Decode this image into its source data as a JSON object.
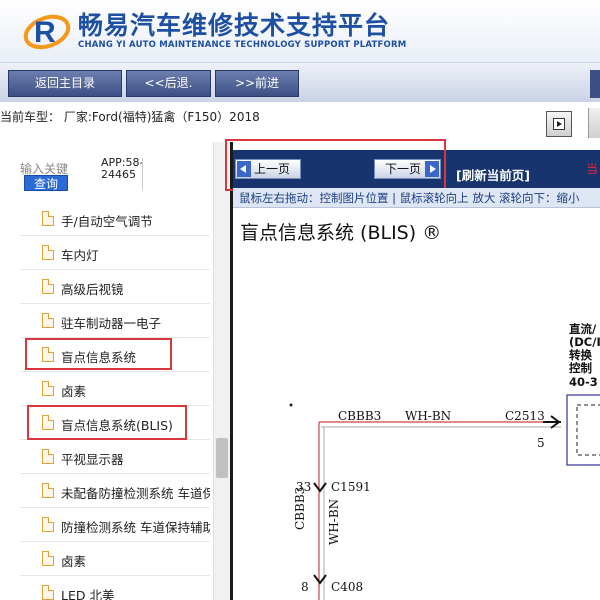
{
  "header": {
    "title_cn": "畅易汽车维修技术支持平台",
    "title_en": "CHANG YI AUTO MAINTENANCE TECHNOLOGY SUPPORT PLATFORM"
  },
  "toolbar": {
    "home_label": "返回主目录",
    "back_label": "<<后退.",
    "forward_label": ">>前进"
  },
  "vehicle": {
    "text": "当前车型：  厂家:Ford(福特)猛禽（F150）2018"
  },
  "sidebar": {
    "search_label": "输入关键",
    "search_button": "查询",
    "app_line1": "APP:58-",
    "app_line2": "24465",
    "items": [
      {
        "label": "手/自动空气调节"
      },
      {
        "label": "车内灯"
      },
      {
        "label": "高级后视镜"
      },
      {
        "label": "驻车制动器一电子"
      },
      {
        "label": "盲点信息系统"
      },
      {
        "label": "卤素"
      },
      {
        "label": "盲点信息系统(BLIS)"
      },
      {
        "label": "平视显示器"
      },
      {
        "label": "未配备防撞检测系统 车道保"
      },
      {
        "label": "防撞检测系统 车道保持辅助"
      },
      {
        "label": "卤素"
      },
      {
        "label": "LED 北美"
      }
    ]
  },
  "viewer": {
    "prev_label": "上一页",
    "next_label": "下一页",
    "refresh_label": "[刷新当前页]",
    "current_label": "当",
    "hint": "鼠标左右拖动：控制图片位置 | 鼠标滚轮向上 放大  滚轮向下：缩小",
    "page_title": "盲点信息系统 (BLIS) ®"
  },
  "diagram": {
    "right_label_l1": "直流/",
    "right_label_l2": "(DC/I",
    "right_label_l3": "转换",
    "right_label_l4": "控制",
    "right_label_l5": "40-3",
    "wire_circuit": "CBBB3",
    "wire_color": "WH-BN",
    "connector_right": "C2513",
    "pin_right": "5",
    "pin_top": "33",
    "connector_mid": "C1591",
    "vertical_circuit": "CBBB3",
    "vertical_color": "WH-BN",
    "pin_bottom": "8",
    "connector_bottom": "C408"
  },
  "colors": {
    "brand_blue": "#1d4fa3",
    "nav_bar": "#17346e",
    "highlight_red": "#d9363e"
  }
}
